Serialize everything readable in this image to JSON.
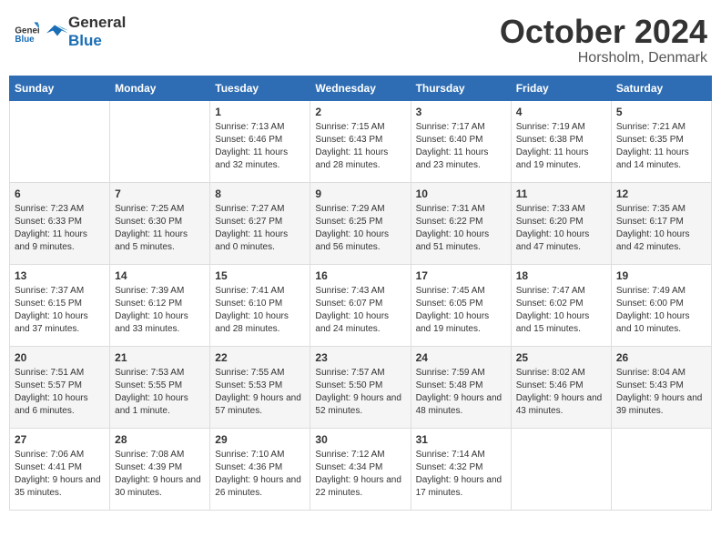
{
  "header": {
    "logo": {
      "text_general": "General",
      "text_blue": "Blue"
    },
    "month": "October 2024",
    "location": "Horsholm, Denmark"
  },
  "weekdays": [
    "Sunday",
    "Monday",
    "Tuesday",
    "Wednesday",
    "Thursday",
    "Friday",
    "Saturday"
  ],
  "weeks": [
    [
      {
        "day": "",
        "sunrise": "",
        "sunset": "",
        "daylight": "",
        "empty": true
      },
      {
        "day": "",
        "sunrise": "",
        "sunset": "",
        "daylight": "",
        "empty": true
      },
      {
        "day": "1",
        "sunrise": "Sunrise: 7:13 AM",
        "sunset": "Sunset: 6:46 PM",
        "daylight": "Daylight: 11 hours and 32 minutes.",
        "empty": false
      },
      {
        "day": "2",
        "sunrise": "Sunrise: 7:15 AM",
        "sunset": "Sunset: 6:43 PM",
        "daylight": "Daylight: 11 hours and 28 minutes.",
        "empty": false
      },
      {
        "day": "3",
        "sunrise": "Sunrise: 7:17 AM",
        "sunset": "Sunset: 6:40 PM",
        "daylight": "Daylight: 11 hours and 23 minutes.",
        "empty": false
      },
      {
        "day": "4",
        "sunrise": "Sunrise: 7:19 AM",
        "sunset": "Sunset: 6:38 PM",
        "daylight": "Daylight: 11 hours and 19 minutes.",
        "empty": false
      },
      {
        "day": "5",
        "sunrise": "Sunrise: 7:21 AM",
        "sunset": "Sunset: 6:35 PM",
        "daylight": "Daylight: 11 hours and 14 minutes.",
        "empty": false
      }
    ],
    [
      {
        "day": "6",
        "sunrise": "Sunrise: 7:23 AM",
        "sunset": "Sunset: 6:33 PM",
        "daylight": "Daylight: 11 hours and 9 minutes.",
        "empty": false
      },
      {
        "day": "7",
        "sunrise": "Sunrise: 7:25 AM",
        "sunset": "Sunset: 6:30 PM",
        "daylight": "Daylight: 11 hours and 5 minutes.",
        "empty": false
      },
      {
        "day": "8",
        "sunrise": "Sunrise: 7:27 AM",
        "sunset": "Sunset: 6:27 PM",
        "daylight": "Daylight: 11 hours and 0 minutes.",
        "empty": false
      },
      {
        "day": "9",
        "sunrise": "Sunrise: 7:29 AM",
        "sunset": "Sunset: 6:25 PM",
        "daylight": "Daylight: 10 hours and 56 minutes.",
        "empty": false
      },
      {
        "day": "10",
        "sunrise": "Sunrise: 7:31 AM",
        "sunset": "Sunset: 6:22 PM",
        "daylight": "Daylight: 10 hours and 51 minutes.",
        "empty": false
      },
      {
        "day": "11",
        "sunrise": "Sunrise: 7:33 AM",
        "sunset": "Sunset: 6:20 PM",
        "daylight": "Daylight: 10 hours and 47 minutes.",
        "empty": false
      },
      {
        "day": "12",
        "sunrise": "Sunrise: 7:35 AM",
        "sunset": "Sunset: 6:17 PM",
        "daylight": "Daylight: 10 hours and 42 minutes.",
        "empty": false
      }
    ],
    [
      {
        "day": "13",
        "sunrise": "Sunrise: 7:37 AM",
        "sunset": "Sunset: 6:15 PM",
        "daylight": "Daylight: 10 hours and 37 minutes.",
        "empty": false
      },
      {
        "day": "14",
        "sunrise": "Sunrise: 7:39 AM",
        "sunset": "Sunset: 6:12 PM",
        "daylight": "Daylight: 10 hours and 33 minutes.",
        "empty": false
      },
      {
        "day": "15",
        "sunrise": "Sunrise: 7:41 AM",
        "sunset": "Sunset: 6:10 PM",
        "daylight": "Daylight: 10 hours and 28 minutes.",
        "empty": false
      },
      {
        "day": "16",
        "sunrise": "Sunrise: 7:43 AM",
        "sunset": "Sunset: 6:07 PM",
        "daylight": "Daylight: 10 hours and 24 minutes.",
        "empty": false
      },
      {
        "day": "17",
        "sunrise": "Sunrise: 7:45 AM",
        "sunset": "Sunset: 6:05 PM",
        "daylight": "Daylight: 10 hours and 19 minutes.",
        "empty": false
      },
      {
        "day": "18",
        "sunrise": "Sunrise: 7:47 AM",
        "sunset": "Sunset: 6:02 PM",
        "daylight": "Daylight: 10 hours and 15 minutes.",
        "empty": false
      },
      {
        "day": "19",
        "sunrise": "Sunrise: 7:49 AM",
        "sunset": "Sunset: 6:00 PM",
        "daylight": "Daylight: 10 hours and 10 minutes.",
        "empty": false
      }
    ],
    [
      {
        "day": "20",
        "sunrise": "Sunrise: 7:51 AM",
        "sunset": "Sunset: 5:57 PM",
        "daylight": "Daylight: 10 hours and 6 minutes.",
        "empty": false
      },
      {
        "day": "21",
        "sunrise": "Sunrise: 7:53 AM",
        "sunset": "Sunset: 5:55 PM",
        "daylight": "Daylight: 10 hours and 1 minute.",
        "empty": false
      },
      {
        "day": "22",
        "sunrise": "Sunrise: 7:55 AM",
        "sunset": "Sunset: 5:53 PM",
        "daylight": "Daylight: 9 hours and 57 minutes.",
        "empty": false
      },
      {
        "day": "23",
        "sunrise": "Sunrise: 7:57 AM",
        "sunset": "Sunset: 5:50 PM",
        "daylight": "Daylight: 9 hours and 52 minutes.",
        "empty": false
      },
      {
        "day": "24",
        "sunrise": "Sunrise: 7:59 AM",
        "sunset": "Sunset: 5:48 PM",
        "daylight": "Daylight: 9 hours and 48 minutes.",
        "empty": false
      },
      {
        "day": "25",
        "sunrise": "Sunrise: 8:02 AM",
        "sunset": "Sunset: 5:46 PM",
        "daylight": "Daylight: 9 hours and 43 minutes.",
        "empty": false
      },
      {
        "day": "26",
        "sunrise": "Sunrise: 8:04 AM",
        "sunset": "Sunset: 5:43 PM",
        "daylight": "Daylight: 9 hours and 39 minutes.",
        "empty": false
      }
    ],
    [
      {
        "day": "27",
        "sunrise": "Sunrise: 7:06 AM",
        "sunset": "Sunset: 4:41 PM",
        "daylight": "Daylight: 9 hours and 35 minutes.",
        "empty": false
      },
      {
        "day": "28",
        "sunrise": "Sunrise: 7:08 AM",
        "sunset": "Sunset: 4:39 PM",
        "daylight": "Daylight: 9 hours and 30 minutes.",
        "empty": false
      },
      {
        "day": "29",
        "sunrise": "Sunrise: 7:10 AM",
        "sunset": "Sunset: 4:36 PM",
        "daylight": "Daylight: 9 hours and 26 minutes.",
        "empty": false
      },
      {
        "day": "30",
        "sunrise": "Sunrise: 7:12 AM",
        "sunset": "Sunset: 4:34 PM",
        "daylight": "Daylight: 9 hours and 22 minutes.",
        "empty": false
      },
      {
        "day": "31",
        "sunrise": "Sunrise: 7:14 AM",
        "sunset": "Sunset: 4:32 PM",
        "daylight": "Daylight: 9 hours and 17 minutes.",
        "empty": false
      },
      {
        "day": "",
        "sunrise": "",
        "sunset": "",
        "daylight": "",
        "empty": true
      },
      {
        "day": "",
        "sunrise": "",
        "sunset": "",
        "daylight": "",
        "empty": true
      }
    ]
  ]
}
